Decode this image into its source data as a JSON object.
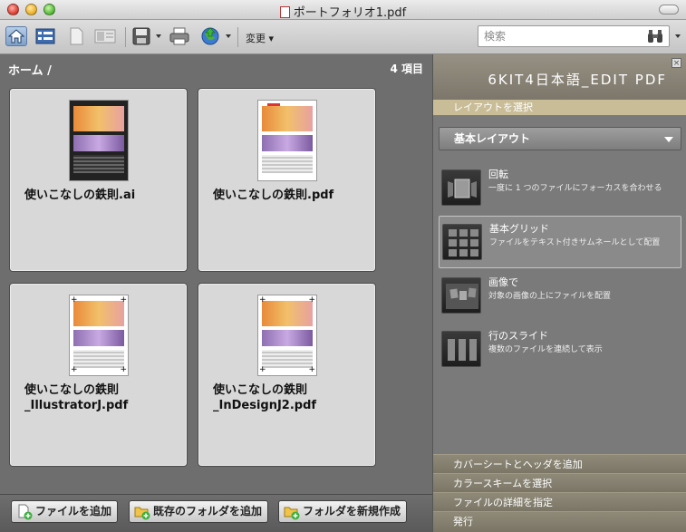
{
  "window": {
    "title": "ポートフォリオ1.pdf"
  },
  "toolbar": {
    "change_label": "変更",
    "search_placeholder": "検索",
    "icons": [
      "home-icon",
      "details-view-icon",
      "page-icon",
      "card-view-icon",
      "save-icon",
      "print-icon",
      "share-globe-icon",
      "binoculars-icon"
    ]
  },
  "content": {
    "breadcrumb": "ホーム  /",
    "item_count": "4 項目",
    "files": [
      {
        "name": "使いこなしの鉄則.ai"
      },
      {
        "name": "使いこなしの鉄則.pdf"
      },
      {
        "name": "使いこなしの鉄則\n_IllustratorJ.pdf"
      },
      {
        "name": "使いこなしの鉄則\n_InDesignJ2.pdf"
      }
    ]
  },
  "bottom_bar": {
    "add_file": "ファイルを追加",
    "add_existing_folder": "既存のフォルダを追加",
    "create_folder": "フォルダを新規作成"
  },
  "panel": {
    "title": "6KIT4日本語_EDIT PDF",
    "close_glyph": "×",
    "subtitle": "レイアウトを選択",
    "layout_select": "基本レイアウト",
    "options": [
      {
        "name": "回転",
        "desc": "一度に 1 つのファイルにフォーカスを合わせる"
      },
      {
        "name": "基本グリッド",
        "desc": "ファイルをテキスト付きサムネールとして配置"
      },
      {
        "name": "画像で",
        "desc": "対象の画像の上にファイルを配置"
      },
      {
        "name": "行のスライド",
        "desc": "複数のファイルを連続して表示"
      }
    ],
    "footer": [
      "カバーシートとヘッダを追加",
      "カラースキームを選択",
      "ファイルの詳細を指定",
      "発行"
    ]
  },
  "colors": {
    "panel_accent": "#c9bd98",
    "content_bg": "#6e6e6e",
    "card_bg": "#d8d8d8"
  }
}
